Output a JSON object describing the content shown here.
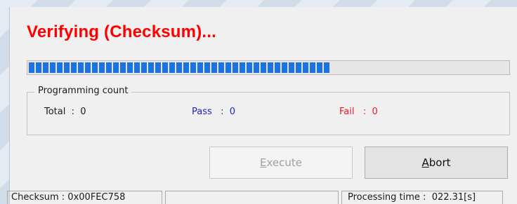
{
  "dialog": {
    "title": "Verifying (Checksum)...",
    "title_color": "#ff0000"
  },
  "progress": {
    "fraction": 0.63,
    "color": "#1a72e6"
  },
  "programming_count": {
    "group_label": "Programming count",
    "total": "Total  :  0",
    "pass": "Pass   :  0",
    "fail": "Fail   :  0",
    "pass_color": "#1f1fc8",
    "fail_color": "#e8192c"
  },
  "buttons": {
    "execute": {
      "mnemonic": "E",
      "rest": "xecute",
      "enabled": false
    },
    "abort": {
      "mnemonic": "A",
      "rest": "bort",
      "enabled": true
    }
  },
  "status": {
    "checksum": "Checksum : 0x00FEC758",
    "middle": "",
    "processing_time": "Processing time :  022.31[s]"
  }
}
